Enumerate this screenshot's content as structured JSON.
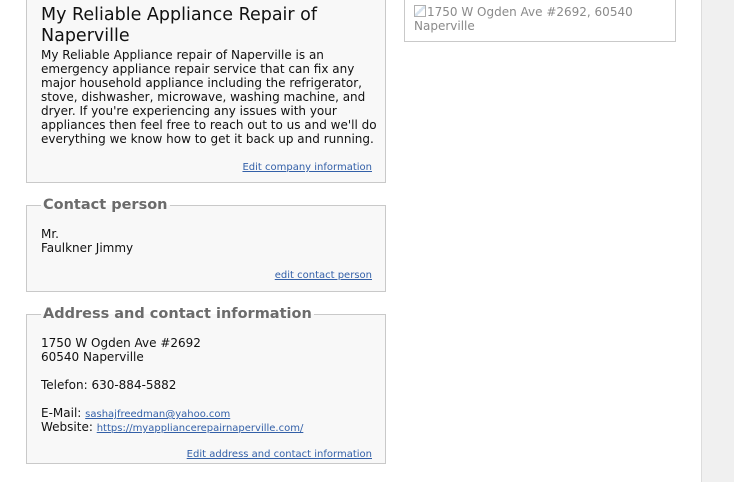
{
  "company": {
    "title": "My Reliable Appliance Repair of Naperville",
    "description": "My Reliable Appliance repair of Naperville is an emergency appliance repair service that can fix any major household appliance including the refrigerator, stove, dishwasher, microwave, washing machine, and dryer. If you're experiencing any issues with your appliances then feel free to reach out to us and we'll do everything we know how to get it back up and running.",
    "edit_label": "Edit company information"
  },
  "contact": {
    "legend": "Contact person",
    "salutation": "Mr.",
    "name": "Faulkner Jimmy",
    "edit_label": "edit contact person"
  },
  "address": {
    "legend": "Address and contact information",
    "street": "1750 W Ogden Ave #2692",
    "city_line": "60540 Naperville",
    "phone_label": "Telefon:",
    "phone": "630-884-5882",
    "email_label": "E-Mail:",
    "email": "sashajfreedman@yahoo.com",
    "website_label": "Website:",
    "website": "https://myappliancerepairnaperville.com/",
    "edit_label": "Edit address and contact information"
  },
  "map": {
    "alt_text": "1750 W Ogden Ave #2692, 60540 Naperville"
  },
  "colors": {
    "link": "#3360a8",
    "legend": "#6b6b6b",
    "box_background": "#f8f8f8",
    "border": "#c9c9c9"
  }
}
